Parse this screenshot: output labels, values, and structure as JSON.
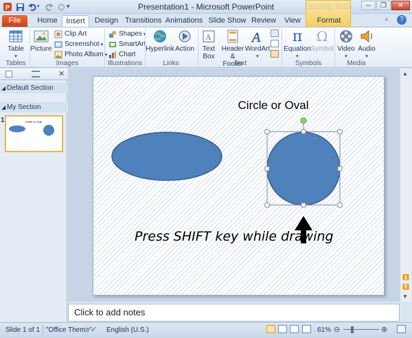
{
  "window": {
    "title": "Presentation1 - Microsoft PowerPoint",
    "contextual_tab": "Drawing Tools"
  },
  "tabs": [
    {
      "label": "File"
    },
    {
      "label": "Home"
    },
    {
      "label": "Insert"
    },
    {
      "label": "Design"
    },
    {
      "label": "Transitions"
    },
    {
      "label": "Animations"
    },
    {
      "label": "Slide Show"
    },
    {
      "label": "Review"
    },
    {
      "label": "View"
    },
    {
      "label": "Format"
    }
  ],
  "active_tab": "Insert",
  "ribbon": {
    "groups": {
      "tables": "Tables",
      "images": "Images",
      "illustrations": "Illustrations",
      "links": "Links",
      "text": "Text",
      "symbols": "Symbols",
      "media": "Media"
    },
    "table": "Table",
    "picture": "Picture",
    "clip_art": "Clip Art",
    "screenshot": "Screenshot",
    "photo_album": "Photo Album",
    "shapes": "Shapes",
    "smartart": "SmartArt",
    "chart": "Chart",
    "hyperlink": "Hyperlink",
    "action": "Action",
    "text_box_1": "Text",
    "text_box_2": "Box",
    "header_1": "Header",
    "header_2": "& Footer",
    "wordart": "WordArt",
    "equation": "Equation",
    "symbol": "Symbol",
    "video": "Video",
    "audio": "Audio"
  },
  "slides_pane": {
    "sections": [
      "Default Section",
      "My Section"
    ],
    "slide_number": "1"
  },
  "slide": {
    "title": "Circle or Oval",
    "caption": "Press SHIFT key while drawing",
    "shape_color": "#4f81bd",
    "shape_border": "#385d8a"
  },
  "notes": {
    "placeholder": "Click to add notes"
  },
  "status_bar": {
    "slide_info": "Slide 1 of 1",
    "theme": "\"Office Theme\"",
    "language": "English (U.S.)",
    "zoom": "61%"
  },
  "icons": [
    "save-icon",
    "undo-icon",
    "redo-icon",
    "minimize-icon",
    "restore-icon",
    "close-icon",
    "help-icon"
  ]
}
